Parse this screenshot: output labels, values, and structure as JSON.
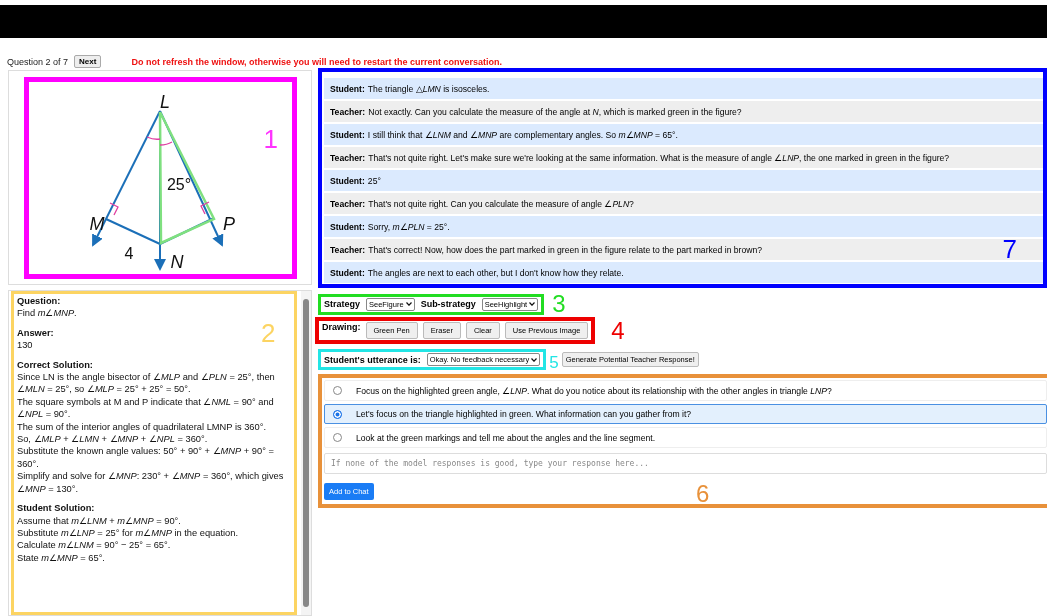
{
  "header": {
    "question_counter": "Question 2 of 7",
    "next_button": "Next",
    "warning": "Do not refresh the window, otherwise you will need to restart the current conversation."
  },
  "figure": {
    "marker": "1",
    "labels": [
      "L",
      "M",
      "N",
      "P",
      "4",
      "25°"
    ]
  },
  "problem": {
    "marker": "2",
    "sections": [
      {
        "heading": "Question:",
        "lines": [
          "Find *m*∠*MNP*."
        ]
      },
      {
        "heading": "Answer:",
        "lines": [
          "130"
        ]
      },
      {
        "heading": "Correct Solution:",
        "lines": [
          "Since LN is the angle bisector of ∠*MLP* and ∠*PLN* = 25°, then ∠*MLN* = 25°, so ∠*MLP* = 25° + 25° = 50°.",
          "The square symbols at M and P indicate that ∠*NML* = 90° and ∠*NPL* = 90°.",
          "The sum of the interior angles of quadrilateral LMNP is 360°.",
          "So, ∠*MLP* + ∠*LMN* + ∠*MNP* + ∠*NPL* = 360°.",
          "Substitute the known angle values: 50° + 90° + ∠*MNP* + 90° = 360°.",
          "Simplify and solve for ∠*MNP*: 230° + ∠*MNP* = 360°, which gives ∠*MNP* = 130°."
        ]
      },
      {
        "heading": "Student Solution:",
        "lines": [
          "Assume that *m*∠*LNM* + *m*∠*MNP* = 90°.",
          "Substitute *m*∠*LNP* = 25° for *m*∠*MNP* in the equation.",
          "Calculate *m*∠*LNM* = 90° − 25° = 65°.",
          "State *m*∠*MNP* = 65°."
        ]
      }
    ]
  },
  "chat": {
    "marker": "7",
    "messages": [
      {
        "kind": "student",
        "speaker": "Student:",
        "text": "The triangle △*LMN* is isosceles."
      },
      {
        "kind": "teacher",
        "speaker": "Teacher:",
        "text": "Not exactly. Can you calculate the measure of the angle at *N*, which is marked green in the figure?"
      },
      {
        "kind": "student",
        "speaker": "Student:",
        "text": "I still think that ∠*LNM* and ∠*MNP* are complementary angles. So *m*∠*MNP* = 65°."
      },
      {
        "kind": "teacher",
        "speaker": "Teacher:",
        "text": "That's not quite right. Let's make sure we're looking at the same information. What is the measure of angle ∠*LNP*, the one marked in green in the figure?"
      },
      {
        "kind": "student",
        "speaker": "Student:",
        "text": "25°"
      },
      {
        "kind": "teacher",
        "speaker": "Teacher:",
        "text": "That's not quite right. Can you calculate the measure of angle ∠*PLN*?"
      },
      {
        "kind": "student",
        "speaker": "Student:",
        "text": "Sorry, *m*∠*PLN* = 25°."
      },
      {
        "kind": "teacher",
        "speaker": "Teacher:",
        "text": "That's correct! Now, how does the part marked in green in the figure relate to the part marked in brown?"
      },
      {
        "kind": "student",
        "speaker": "Student:",
        "text": "The angles are next to each other, but I don't know how they relate."
      }
    ]
  },
  "strategy": {
    "marker": "3",
    "label": "Strategy",
    "value": "SeeFigure",
    "sub_label": "Sub-strategy",
    "sub_value": "SeeHighlight"
  },
  "drawing": {
    "marker": "4",
    "label": "Drawing:",
    "buttons": [
      "Green Pen",
      "Eraser",
      "Clear",
      "Use Previous Image"
    ]
  },
  "utterance": {
    "marker": "5",
    "label": "Student's utterance is:",
    "value": "Okay. No feedback necessary",
    "button": "Generate Potential Teacher Response!"
  },
  "responses": {
    "marker": "6",
    "options": [
      {
        "text": "Focus on the highlighted green angle, ∠*LNP*. What do you notice about its relationship with the other angles in triangle *LNP*?",
        "selected": false
      },
      {
        "text": "Let's focus on the triangle highlighted in green. What information can you gather from it?",
        "selected": true
      },
      {
        "text": "Look at the green markings and tell me about the angles and the line segment.",
        "selected": false
      }
    ],
    "placeholder": "If none of the model responses is good, type your response here...",
    "button": "Add to Chat"
  }
}
